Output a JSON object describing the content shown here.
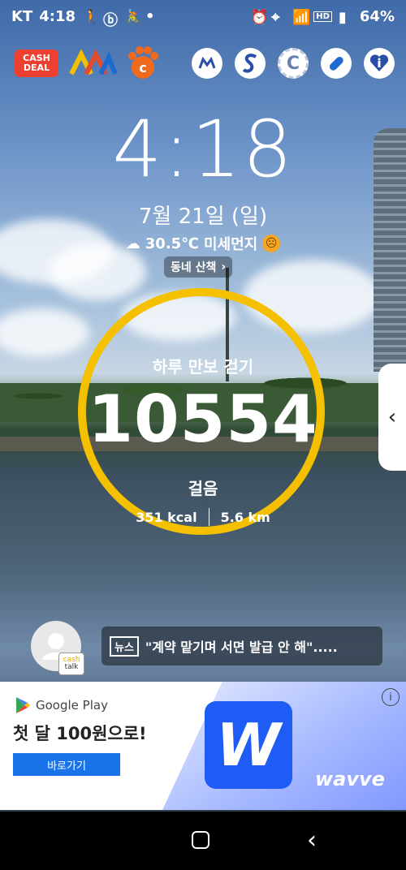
{
  "status_bar": {
    "carrier": "KT",
    "time": "4:18",
    "battery": "64%"
  },
  "apps": {
    "cash_deal_label_line1": "CASH",
    "cash_deal_label_line2": "DEAL",
    "coin_app_letter": "C"
  },
  "lockscreen": {
    "clock": "4:18",
    "date": "7월 21일 (일)",
    "weather_temp": "30.5℃",
    "weather_dust": "미세먼지",
    "walk_button": "동네 산책"
  },
  "pedometer": {
    "title": "하루 만보 걷기",
    "steps": "10554",
    "unit": "걸음",
    "kcal": "351 kcal",
    "distance": "5.6 km",
    "ring_color": "#f4c000"
  },
  "cashtalk": {
    "badge_line1": "cash",
    "badge_line2": "talk"
  },
  "news": {
    "tag": "뉴스",
    "headline": "\"계약 맡기며 서면 발급 안 해\"....."
  },
  "ad": {
    "store": "Google Play",
    "headline": "첫 달 100원으로!",
    "button": "바로가기",
    "logo_letter": "W",
    "brand": "wavve",
    "info": "i"
  }
}
